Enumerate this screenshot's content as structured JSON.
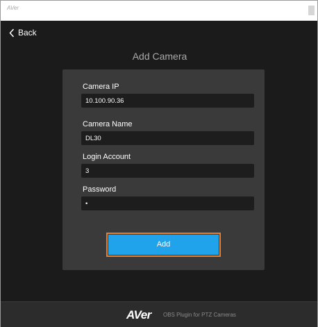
{
  "window": {
    "title": "AVer"
  },
  "nav": {
    "back_label": "Back"
  },
  "page": {
    "heading": "Add Camera"
  },
  "form": {
    "camera_ip": {
      "label": "Camera IP",
      "value": "10.100.90.36"
    },
    "camera_name": {
      "label": "Camera Name",
      "value": "DL30"
    },
    "login_account": {
      "label": "Login Account",
      "value": "3"
    },
    "password": {
      "label": "Password",
      "value": "•"
    },
    "add_label": "Add"
  },
  "footer": {
    "brand": "AVer",
    "tagline": "OBS Plugin for PTZ Cameras"
  },
  "colors": {
    "background": "#1b1b1b",
    "panel": "#3a3a3a",
    "input_bg": "#1d1d1d",
    "add_button": "#21a3ec",
    "focus_outline": "#ee7d2b",
    "footer": "#2c2c2c"
  },
  "icons": {
    "back": "chevron-left-icon"
  }
}
